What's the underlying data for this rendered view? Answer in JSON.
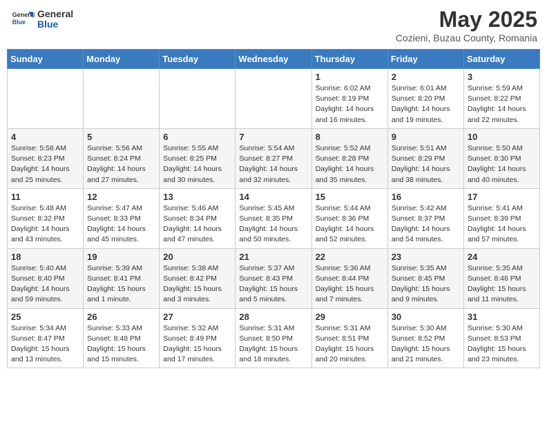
{
  "header": {
    "logo_general": "General",
    "logo_blue": "Blue",
    "month_title": "May 2025",
    "subtitle": "Cozieni, Buzau County, Romania"
  },
  "days_of_week": [
    "Sunday",
    "Monday",
    "Tuesday",
    "Wednesday",
    "Thursday",
    "Friday",
    "Saturday"
  ],
  "weeks": [
    [
      {
        "day": "",
        "info": ""
      },
      {
        "day": "",
        "info": ""
      },
      {
        "day": "",
        "info": ""
      },
      {
        "day": "",
        "info": ""
      },
      {
        "day": "1",
        "info": "Sunrise: 6:02 AM\nSunset: 8:19 PM\nDaylight: 14 hours\nand 16 minutes."
      },
      {
        "day": "2",
        "info": "Sunrise: 6:01 AM\nSunset: 8:20 PM\nDaylight: 14 hours\nand 19 minutes."
      },
      {
        "day": "3",
        "info": "Sunrise: 5:59 AM\nSunset: 8:22 PM\nDaylight: 14 hours\nand 22 minutes."
      }
    ],
    [
      {
        "day": "4",
        "info": "Sunrise: 5:58 AM\nSunset: 8:23 PM\nDaylight: 14 hours\nand 25 minutes."
      },
      {
        "day": "5",
        "info": "Sunrise: 5:56 AM\nSunset: 8:24 PM\nDaylight: 14 hours\nand 27 minutes."
      },
      {
        "day": "6",
        "info": "Sunrise: 5:55 AM\nSunset: 8:25 PM\nDaylight: 14 hours\nand 30 minutes."
      },
      {
        "day": "7",
        "info": "Sunrise: 5:54 AM\nSunset: 8:27 PM\nDaylight: 14 hours\nand 32 minutes."
      },
      {
        "day": "8",
        "info": "Sunrise: 5:52 AM\nSunset: 8:28 PM\nDaylight: 14 hours\nand 35 minutes."
      },
      {
        "day": "9",
        "info": "Sunrise: 5:51 AM\nSunset: 8:29 PM\nDaylight: 14 hours\nand 38 minutes."
      },
      {
        "day": "10",
        "info": "Sunrise: 5:50 AM\nSunset: 8:30 PM\nDaylight: 14 hours\nand 40 minutes."
      }
    ],
    [
      {
        "day": "11",
        "info": "Sunrise: 5:48 AM\nSunset: 8:32 PM\nDaylight: 14 hours\nand 43 minutes."
      },
      {
        "day": "12",
        "info": "Sunrise: 5:47 AM\nSunset: 8:33 PM\nDaylight: 14 hours\nand 45 minutes."
      },
      {
        "day": "13",
        "info": "Sunrise: 5:46 AM\nSunset: 8:34 PM\nDaylight: 14 hours\nand 47 minutes."
      },
      {
        "day": "14",
        "info": "Sunrise: 5:45 AM\nSunset: 8:35 PM\nDaylight: 14 hours\nand 50 minutes."
      },
      {
        "day": "15",
        "info": "Sunrise: 5:44 AM\nSunset: 8:36 PM\nDaylight: 14 hours\nand 52 minutes."
      },
      {
        "day": "16",
        "info": "Sunrise: 5:42 AM\nSunset: 8:37 PM\nDaylight: 14 hours\nand 54 minutes."
      },
      {
        "day": "17",
        "info": "Sunrise: 5:41 AM\nSunset: 8:39 PM\nDaylight: 14 hours\nand 57 minutes."
      }
    ],
    [
      {
        "day": "18",
        "info": "Sunrise: 5:40 AM\nSunset: 8:40 PM\nDaylight: 14 hours\nand 59 minutes."
      },
      {
        "day": "19",
        "info": "Sunrise: 5:39 AM\nSunset: 8:41 PM\nDaylight: 15 hours\nand 1 minute."
      },
      {
        "day": "20",
        "info": "Sunrise: 5:38 AM\nSunset: 8:42 PM\nDaylight: 15 hours\nand 3 minutes."
      },
      {
        "day": "21",
        "info": "Sunrise: 5:37 AM\nSunset: 8:43 PM\nDaylight: 15 hours\nand 5 minutes."
      },
      {
        "day": "22",
        "info": "Sunrise: 5:36 AM\nSunset: 8:44 PM\nDaylight: 15 hours\nand 7 minutes."
      },
      {
        "day": "23",
        "info": "Sunrise: 5:35 AM\nSunset: 8:45 PM\nDaylight: 15 hours\nand 9 minutes."
      },
      {
        "day": "24",
        "info": "Sunrise: 5:35 AM\nSunset: 8:46 PM\nDaylight: 15 hours\nand 11 minutes."
      }
    ],
    [
      {
        "day": "25",
        "info": "Sunrise: 5:34 AM\nSunset: 8:47 PM\nDaylight: 15 hours\nand 13 minutes."
      },
      {
        "day": "26",
        "info": "Sunrise: 5:33 AM\nSunset: 8:48 PM\nDaylight: 15 hours\nand 15 minutes."
      },
      {
        "day": "27",
        "info": "Sunrise: 5:32 AM\nSunset: 8:49 PM\nDaylight: 15 hours\nand 17 minutes."
      },
      {
        "day": "28",
        "info": "Sunrise: 5:31 AM\nSunset: 8:50 PM\nDaylight: 15 hours\nand 18 minutes."
      },
      {
        "day": "29",
        "info": "Sunrise: 5:31 AM\nSunset: 8:51 PM\nDaylight: 15 hours\nand 20 minutes."
      },
      {
        "day": "30",
        "info": "Sunrise: 5:30 AM\nSunset: 8:52 PM\nDaylight: 15 hours\nand 21 minutes."
      },
      {
        "day": "31",
        "info": "Sunrise: 5:30 AM\nSunset: 8:53 PM\nDaylight: 15 hours\nand 23 minutes."
      }
    ]
  ]
}
